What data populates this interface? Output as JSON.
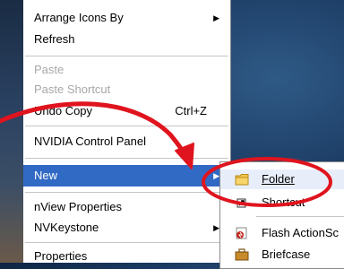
{
  "context_menu": {
    "items": [
      {
        "label": "Arrange Icons By",
        "has_submenu": true
      },
      {
        "label": "Refresh"
      },
      {
        "label": "Paste",
        "disabled": true
      },
      {
        "label": "Paste Shortcut",
        "disabled": true
      },
      {
        "label": "Undo Copy",
        "shortcut": "Ctrl+Z"
      },
      {
        "label": "NVIDIA Control Panel"
      },
      {
        "label": "New",
        "has_submenu": true,
        "highlighted": true
      },
      {
        "label": "nView Properties"
      },
      {
        "label": "NVKeystone",
        "has_submenu": true
      },
      {
        "label": "Properties"
      }
    ],
    "highlight_color": "#316ac5"
  },
  "new_submenu": {
    "items": [
      {
        "label": "Folder",
        "icon": "folder-icon"
      },
      {
        "label": "Shortcut",
        "icon": "shortcut-icon"
      },
      {
        "label": "Flash ActionSc",
        "icon": "flash-icon"
      },
      {
        "label": "Briefcase",
        "icon": "briefcase-icon"
      }
    ]
  },
  "annotation_color": "#e0141e"
}
